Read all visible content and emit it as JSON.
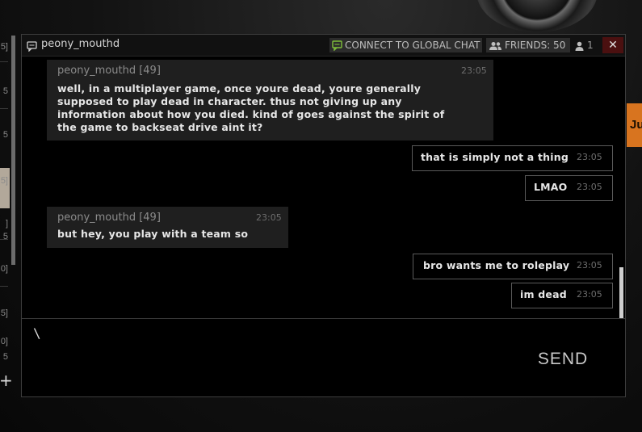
{
  "window": {
    "title": "peony_mouthd",
    "global_chat_label": "CONNECT TO GLOBAL CHAT",
    "friends_label": "FRIENDS: 50",
    "online_count": "1",
    "close_symbol": "✕"
  },
  "background": {
    "side_tab_text": "Jui",
    "left_numbers": [
      "5]",
      "5",
      "5",
      "5]",
      "]",
      "5",
      "0]",
      "5]",
      "0]",
      "5"
    ]
  },
  "messages": [
    {
      "direction": "incoming",
      "sender": "peony_mouthd [49]",
      "time": "23:05",
      "text": "well, in a multiplayer game, once youre dead, youre generally\nsupposed to play dead in character. thus not giving up any\ninformation about how you died. kind of goes against the spirit of\nthe game to backseat drive aint it?"
    },
    {
      "direction": "outgoing",
      "text": "that is simply not a thing",
      "time": "23:05"
    },
    {
      "direction": "outgoing",
      "text": "LMAO",
      "time": "23:05"
    },
    {
      "direction": "incoming",
      "sender": "peony_mouthd [49]",
      "time": "23:05",
      "text": "but hey, you play with a team so"
    },
    {
      "direction": "outgoing",
      "text": "bro wants me to roleplay",
      "time": "23:05"
    },
    {
      "direction": "outgoing",
      "text": "im dead",
      "time": "23:05"
    }
  ],
  "input": {
    "value": "\\"
  },
  "send_label": "SEND",
  "colors": {
    "close_bg": "#4b1010",
    "accent_green": "#7fbf3a",
    "side_tab": "#d8741f"
  },
  "icons": {
    "title": "chat-bubble-icon",
    "global_chat": "chat-bubble-icon",
    "friends": "friends-icon",
    "online": "user-icon"
  }
}
